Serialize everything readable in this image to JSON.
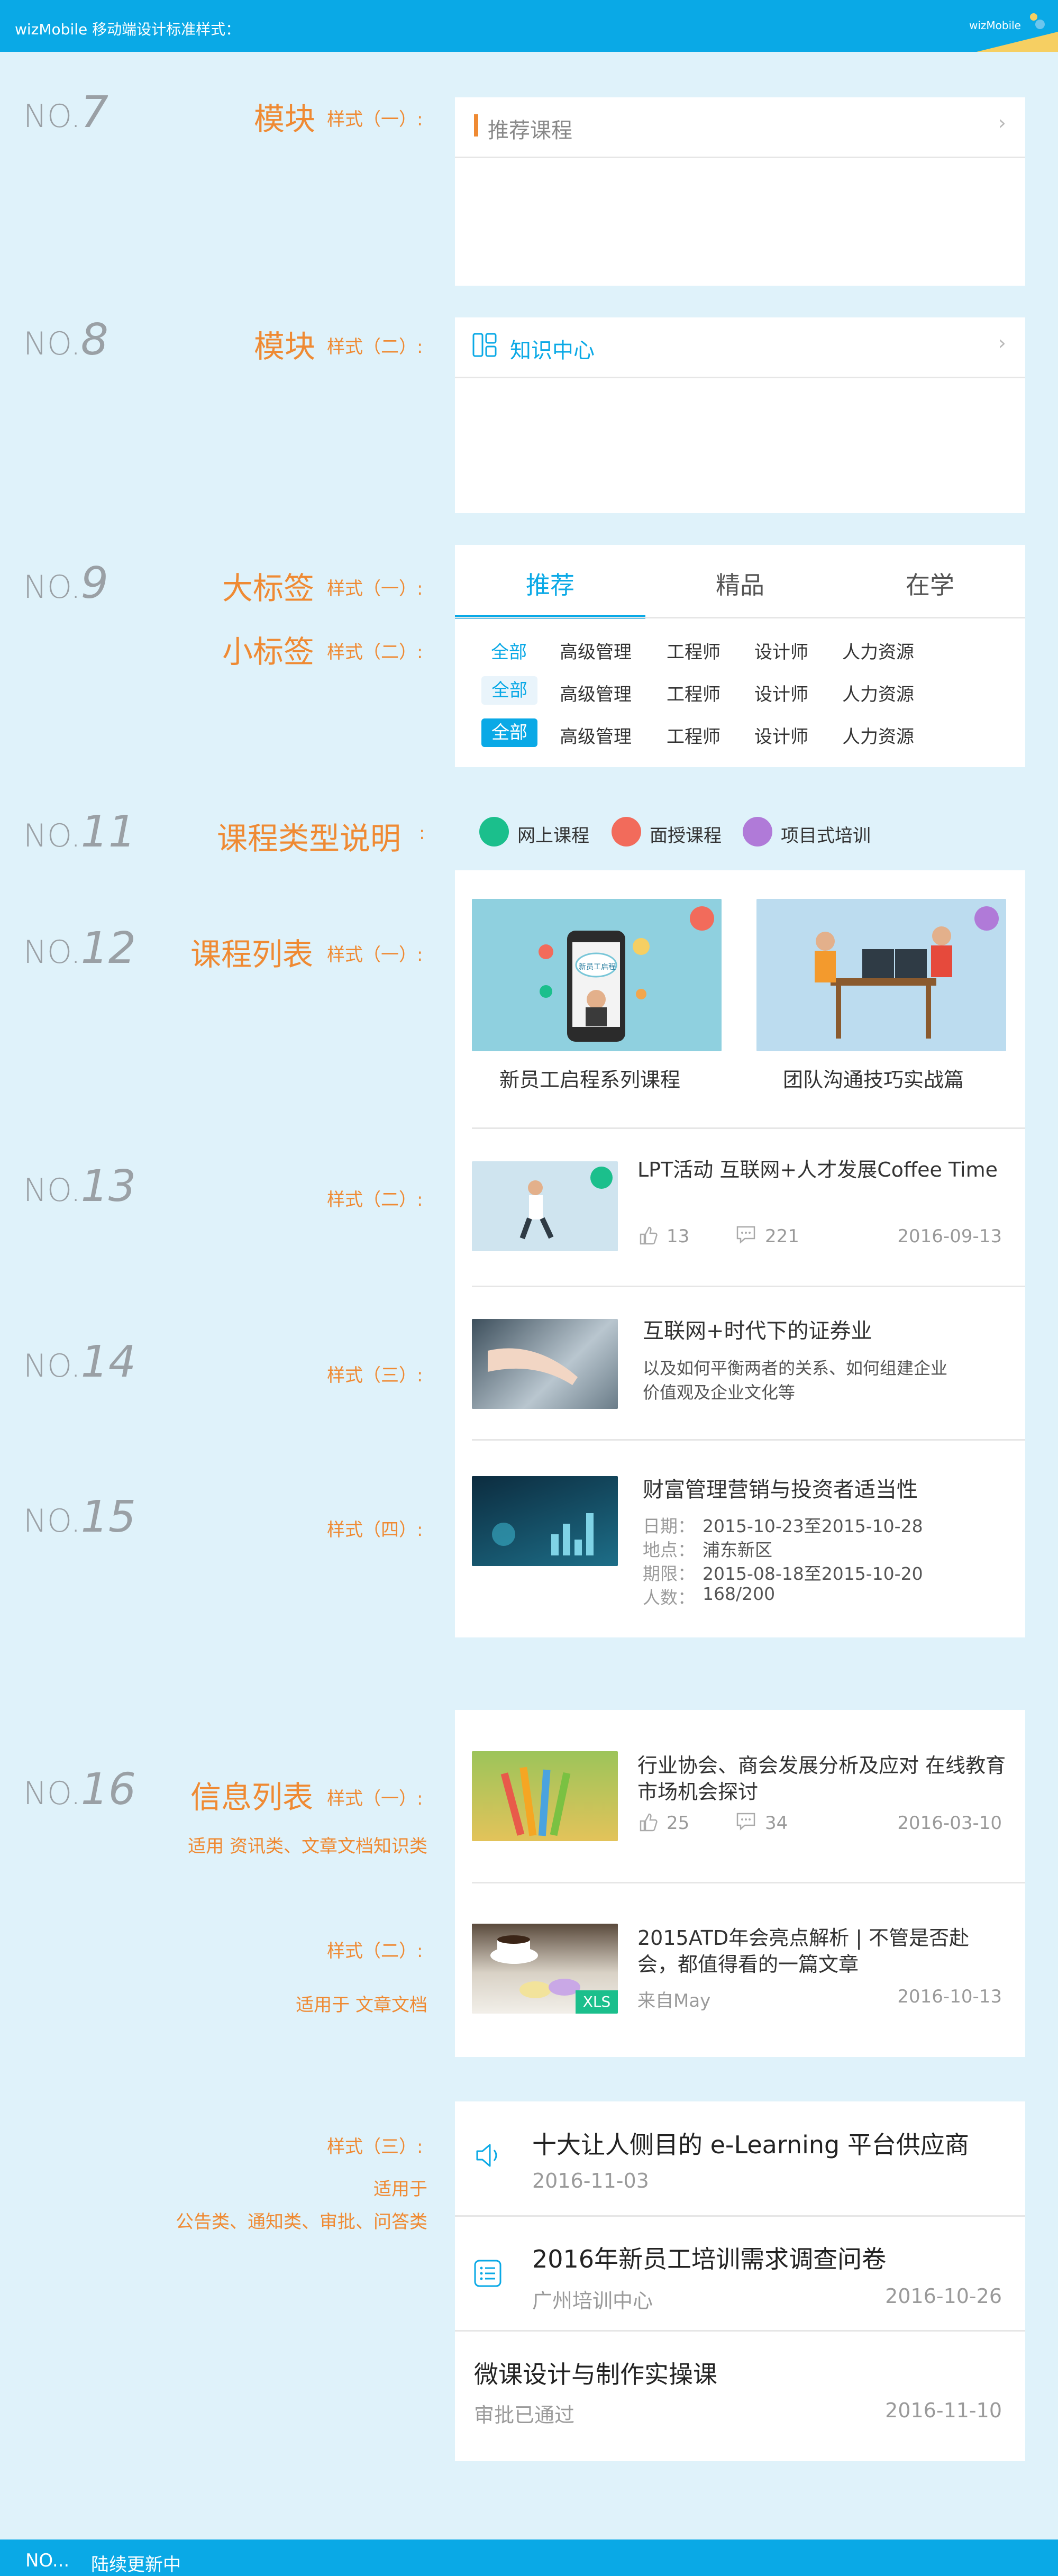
{
  "header": {
    "title": "wizMobile 移动端设计标准样式：",
    "logo": "wizMobile"
  },
  "footer": {
    "no_label": "NO...",
    "text": "陆续更新中"
  },
  "labels": {
    "no_prefix": "NO.",
    "n7": "7",
    "n8": "8",
    "n9": "9",
    "n11": "11",
    "n12": "12",
    "n13": "13",
    "n14": "14",
    "n15": "15",
    "n16": "16",
    "module": "模块",
    "style1": "样式（一）:",
    "style2": "样式（二）:",
    "style3": "样式（三）:",
    "style4": "样式（四）:",
    "big_tag": "大标签",
    "small_tag": "小标签",
    "course_type": "课程类型说明",
    "colon": ":",
    "course_list": "课程列表",
    "info_list": "信息列表",
    "info_note1": "适用 资讯类、文章文档知识类",
    "info_note2": "适用于 文章文档",
    "info_note3a": "适用于",
    "info_note3b": "公告类、通知类、审批、问答类"
  },
  "module1": {
    "title": "推荐课程"
  },
  "module2": {
    "title": "知识中心"
  },
  "tabs": {
    "items": [
      "推荐",
      "精品",
      "在学"
    ]
  },
  "small_tags": {
    "items": [
      "全部",
      "高级管理",
      "工程师",
      "设计师",
      "人力资源"
    ]
  },
  "course_types": {
    "items": [
      "网上课程",
      "面授课程",
      "项目式培训"
    ]
  },
  "course_grid": {
    "items": [
      "新员工启程系列课程",
      "团队沟通技巧实战篇"
    ],
    "img1_caption": "新员工启程"
  },
  "list13": {
    "title": "LPT活动 互联网+人才发展Coffee Time",
    "likes": "13",
    "comments": "221",
    "date": "2016-09-13"
  },
  "list14": {
    "title": "互联网+时代下的证券业",
    "desc": "以及如何平衡两者的关系、如何组建企业价值观及企业文化等"
  },
  "list15": {
    "title": "财富管理营销与投资者适当性",
    "rows": [
      {
        "k": "日期：",
        "v": "2015-10-23至2015-10-28"
      },
      {
        "k": "地点：",
        "v": "浦东新区"
      },
      {
        "k": "期限：",
        "v": "2015-08-18至2015-10-20"
      },
      {
        "k": "人数：",
        "v": "168/200"
      }
    ]
  },
  "info1": {
    "title": "行业协会、商会发展分析及应对 在线教育市场机会探讨",
    "likes": "25",
    "comments": "34",
    "date": "2016-03-10"
  },
  "info2": {
    "title": "2015ATD年会亮点解析 | 不管是否赴会，都值得看的一篇文章",
    "source": "来自May",
    "date": "2016-10-13",
    "badge": "XLS"
  },
  "info3": [
    {
      "title": "十大让人侧目的 e-Learning 平台供应商",
      "sub": "",
      "date": "2016-11-03"
    },
    {
      "title": "2016年新员工培训需求调查问卷",
      "sub": "广州培训中心",
      "date": "2016-10-26"
    },
    {
      "title": "微课设计与制作实操课",
      "sub": "审批已通过",
      "date": "2016-11-10"
    }
  ],
  "colors": {
    "accent": "#0aa9e6",
    "orange": "#ef8a33",
    "online": "#1bbf8c",
    "face": "#f26b5b",
    "project": "#b07ad8",
    "bg": "#dff2fa"
  }
}
